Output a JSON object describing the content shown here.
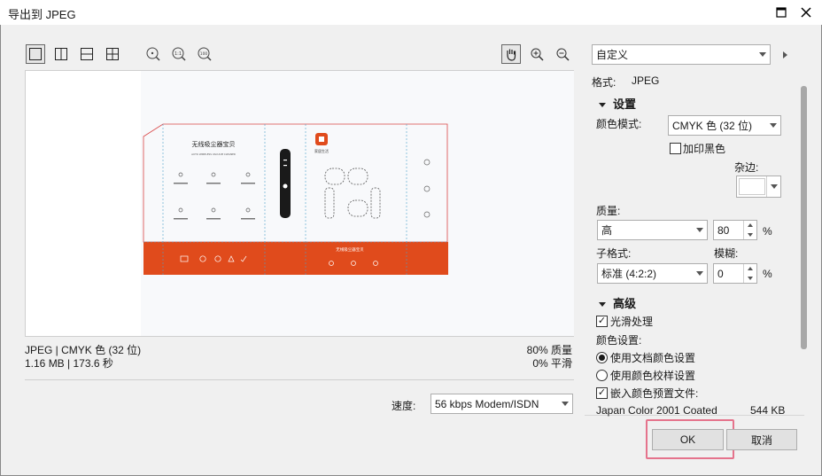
{
  "window": {
    "title": "导出到 JPEG"
  },
  "preview": {
    "info_left_1": "JPEG | CMYK 色 (32 位)",
    "info_left_2": "1.16 MB | 173.6 秒",
    "info_right_1": "80% 质量",
    "info_right_2": "0% 平滑"
  },
  "package": {
    "title": "无线吸尘器宝贝",
    "subtitle": "AUTO WIRELESS VACUUM CLEANER",
    "strip_text": "无线吸尘器宝贝",
    "brand": "家居生活"
  },
  "speed": {
    "label": "速度:",
    "value": "56 kbps Modem/ISDN"
  },
  "preset": {
    "value": "自定义"
  },
  "format": {
    "label": "格式:",
    "value": "JPEG"
  },
  "settings": {
    "header": "设置",
    "color_mode_label": "颜色模式:",
    "color_mode_value": "CMYK 色 (32 位)",
    "overprint_black": "加印黑色",
    "matte_label": "杂边:",
    "matte_color": "#ffffff",
    "quality_label": "质量:",
    "quality_value": "高",
    "quality_number": "80",
    "percent": "%",
    "subformat_label": "子格式:",
    "subformat_value": "标准 (4:2:2)",
    "blur_label": "模糊:",
    "blur_number": "0"
  },
  "advanced": {
    "header": "高级",
    "antialias": "光滑处理",
    "color_settings_label": "颜色设置:",
    "use_doc_color": "使用文档颜色设置",
    "use_proof_color": "使用颜色校样设置",
    "embed_profile": "嵌入颜色预置文件:",
    "profile_name": "Japan Color 2001 Coated",
    "profile_size": "544 KB"
  },
  "buttons": {
    "ok": "OK",
    "cancel": "取消"
  },
  "colors": {
    "accent_orange": "#e04b1c",
    "highlight": "#e5738c"
  }
}
